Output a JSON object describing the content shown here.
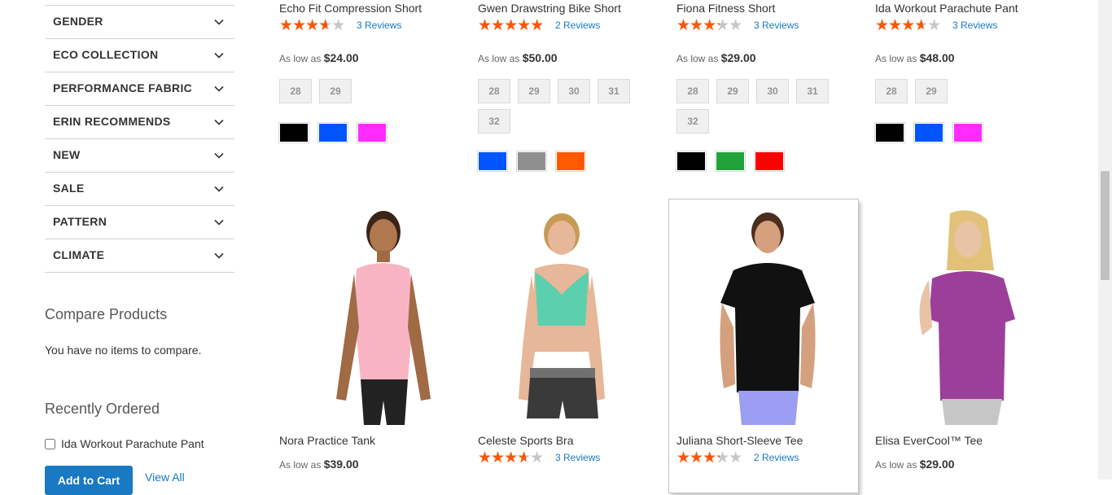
{
  "sidebar": {
    "filters": [
      {
        "label": "GENDER"
      },
      {
        "label": "ECO COLLECTION"
      },
      {
        "label": "PERFORMANCE FABRIC"
      },
      {
        "label": "ERIN RECOMMENDS"
      },
      {
        "label": "NEW"
      },
      {
        "label": "SALE"
      },
      {
        "label": "PATTERN"
      },
      {
        "label": "CLIMATE"
      }
    ],
    "compare": {
      "title": "Compare Products",
      "empty": "You have no items to compare."
    },
    "recently_ordered": {
      "title": "Recently Ordered",
      "item": "Ida Workout Parachute Pant",
      "add_to_cart": "Add to Cart",
      "view_all": "View All"
    }
  },
  "products": [
    {
      "name": "Echo Fit Compression Short",
      "rating_pct": 67,
      "reviews": "3 Reviews",
      "price_prefix": "As low as",
      "price": "$24.00",
      "sizes": [
        "28",
        "29"
      ],
      "colors": [
        "#000000",
        "#0055ff",
        "#ff2bff"
      ]
    },
    {
      "name": "Gwen Drawstring Bike Short",
      "rating_pct": 90,
      "reviews": "2 Reviews",
      "price_prefix": "As low as",
      "price": "$50.00",
      "sizes": [
        "28",
        "29",
        "30",
        "31",
        "32"
      ],
      "colors": [
        "#0055ff",
        "#8f8f8f",
        "#ff5a00"
      ]
    },
    {
      "name": "Fiona Fitness Short",
      "rating_pct": 60,
      "reviews": "3 Reviews",
      "price_prefix": "As low as",
      "price": "$29.00",
      "sizes": [
        "28",
        "29",
        "30",
        "31",
        "32"
      ],
      "colors": [
        "#000000",
        "#21a23a",
        "#ff0000"
      ]
    },
    {
      "name": "Ida Workout Parachute Pant",
      "rating_pct": 67,
      "reviews": "3 Reviews",
      "price_prefix": "As low as",
      "price": "$48.00",
      "sizes": [
        "28",
        "29"
      ],
      "colors": [
        "#000000",
        "#0055ff",
        "#ff2bff"
      ]
    },
    {
      "name": "Nora Practice Tank",
      "price_prefix": "As low as",
      "price": "$39.00"
    },
    {
      "name": "Celeste Sports Bra",
      "rating_pct": 67,
      "reviews": "3 Reviews"
    },
    {
      "name": "Juliana Short-Sleeve Tee",
      "rating_pct": 60,
      "reviews": "2 Reviews"
    },
    {
      "name": "Elisa EverCool™ Tee",
      "price_prefix": "As low as",
      "price": "$29.00"
    }
  ]
}
